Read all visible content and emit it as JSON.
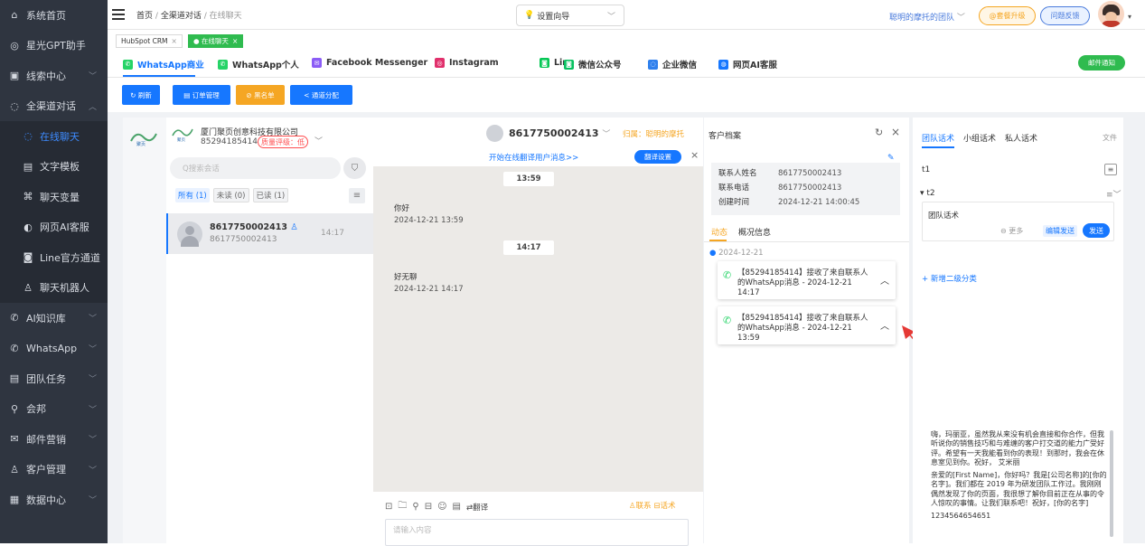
{
  "sidebar": {
    "items": [
      {
        "label": "系统首页",
        "icon": "home-icon",
        "type": "top"
      },
      {
        "label": "星光GPT助手",
        "icon": "gpt-icon",
        "type": "top"
      },
      {
        "label": "线索中心",
        "icon": "leads-icon",
        "type": "top",
        "arrow": "﹀"
      },
      {
        "label": "全渠道对话",
        "icon": "chat-icon",
        "type": "top",
        "arrow": "︿"
      },
      {
        "label": "在线聊天",
        "icon": "online-chat-icon",
        "type": "sub",
        "active": true
      },
      {
        "label": "文字模板",
        "icon": "template-icon",
        "type": "sub"
      },
      {
        "label": "聊天变量",
        "icon": "variable-icon",
        "type": "sub"
      },
      {
        "label": "网页AI客服",
        "icon": "ai-service-icon",
        "type": "sub"
      },
      {
        "label": "Line官方通道",
        "icon": "line-channel-icon",
        "type": "sub"
      },
      {
        "label": "聊天机器人",
        "icon": "robot-icon",
        "type": "sub"
      },
      {
        "label": "AI知识库",
        "icon": "knowledge-icon",
        "type": "top",
        "arrow": "﹀"
      },
      {
        "label": "WhatsApp",
        "icon": "whatsapp-icon",
        "type": "top",
        "arrow": "﹀"
      },
      {
        "label": "团队任务",
        "icon": "task-icon",
        "type": "top",
        "arrow": "﹀"
      },
      {
        "label": "会邦",
        "icon": "location-icon",
        "type": "top",
        "arrow": "﹀"
      },
      {
        "label": "邮件营销",
        "icon": "mail-icon",
        "type": "top",
        "arrow": "﹀"
      },
      {
        "label": "客户管理",
        "icon": "customer-icon",
        "type": "top",
        "arrow": "﹀"
      },
      {
        "label": "数据中心",
        "icon": "data-icon",
        "type": "top",
        "arrow": "﹀"
      }
    ]
  },
  "topbar": {
    "crumb_home": "首页",
    "crumb_sep": "/",
    "crumb_section": "全渠道对话",
    "crumb_current": "在线聊天",
    "wizard": "设置向导",
    "team": "聪明的摩托的团队",
    "upgrade": "@套餐升级",
    "feedback": "问题反馈"
  },
  "tags": {
    "hubspot": "HubSpot CRM",
    "close": "×",
    "online": "● 在线聊天"
  },
  "channels": [
    {
      "label": "WhatsApp商业",
      "icon": "whatsapp-business-icon",
      "color": "#25d366",
      "active": true
    },
    {
      "label": "WhatsApp个人",
      "icon": "whatsapp-personal-icon",
      "color": "#25d366"
    },
    {
      "label": "Facebook Messenger",
      "icon": "messenger-icon",
      "color": "#8b5cf6"
    },
    {
      "label": "Instagram",
      "icon": "instagram-icon",
      "color": "#e1306c"
    },
    {
      "label": "Line",
      "icon": "line-icon",
      "color": "#06c755"
    },
    {
      "label": "微信公众号",
      "icon": "wechat-official-icon",
      "color": "#07c160"
    },
    {
      "label": "企业微信",
      "icon": "wecom-icon",
      "color": "#2f80ed"
    },
    {
      "label": "网页AI客服",
      "icon": "web-ai-icon",
      "color": "#1677ff"
    }
  ],
  "mail_notify": "邮件通知",
  "actions": {
    "refresh": "↻ 刷新",
    "orders": "▤ 订单管理",
    "blacklist": "⊘ 黑名单",
    "assign": "< 通道分配"
  },
  "account": {
    "name": "厦门聚页创意科技有限公司",
    "phone": "85294185414",
    "quality": "质量评级：低"
  },
  "conv": {
    "search_placeholder": "Q搜索会话",
    "filters": {
      "all": "所有 (1)",
      "unread": "未读 (0)",
      "read": "已读 (1)"
    },
    "item": {
      "name": "8617750002413",
      "sub": "8617750002413",
      "time": "14:17"
    }
  },
  "chat": {
    "contact": "8617750002413",
    "owner": "归属：聪明的摩托",
    "translate_link": "开始在线翻译用户消息>>",
    "translate_btn": "翻译设置",
    "time1": "13:59",
    "msg1": "你好",
    "msg1_time": "2024-12-21 13:59",
    "time2": "14:17",
    "msg2": "好无聊",
    "msg2_time": "2024-12-21 14:17",
    "translate": "翻译",
    "contact_link": "联系",
    "script_link": "话术",
    "input_placeholder": "请输入内容"
  },
  "profile": {
    "title": "客户档案",
    "fields": [
      {
        "label": "联系人姓名",
        "value": "8617750002413"
      },
      {
        "label": "联系电话",
        "value": "8617750002413"
      },
      {
        "label": "创建时间",
        "value": "2024-12-21 14:00:45"
      }
    ],
    "tab_activity": "动态",
    "tab_overview": "概况信息",
    "date": "2024-12-21",
    "events": [
      {
        "text": "【85294185414】接收了来自联系人的WhatsApp消息 - 2024-12-21 14:17"
      },
      {
        "text": "【85294185414】接收了来自联系人的WhatsApp消息 - 2024-12-21 13:59"
      }
    ]
  },
  "scripts": {
    "tabs": [
      "团队话术",
      "小组话术",
      "私人话术"
    ],
    "file_link": "文件",
    "group1": "t1",
    "group2": "▾ t2",
    "item_title": "团队话术",
    "more": "⊖ 更多",
    "edit_send": "编辑发送",
    "send": "发送",
    "add_category": "+ 新增二级分类",
    "template1": "嗨，玛丽亚，虽然我从来没有机会直接和你合作，但我听说你的销售技巧和与难缠的客户打交道的能力广受好评。希望有一天我能看到你的表现！到那时，我会在休息室见到你。祝好， 艾米丽",
    "template2": "亲爱的[First Name]，你好吗？我是[公司名称]的[你的名字]。我们都在 2019 年为研发团队工作过。我刚刚偶然发现了你的页面，我很想了解你目前正在从事的令人惊叹的事情。让我们联系吧！祝好，[你的名字]",
    "template3": "1234564654651"
  },
  "colors": {
    "sidebar_bg": "#2f3540",
    "accent": "#1677ff",
    "orange": "#f5a623",
    "whatsapp": "#25d366",
    "danger": "#ff4d4f"
  }
}
